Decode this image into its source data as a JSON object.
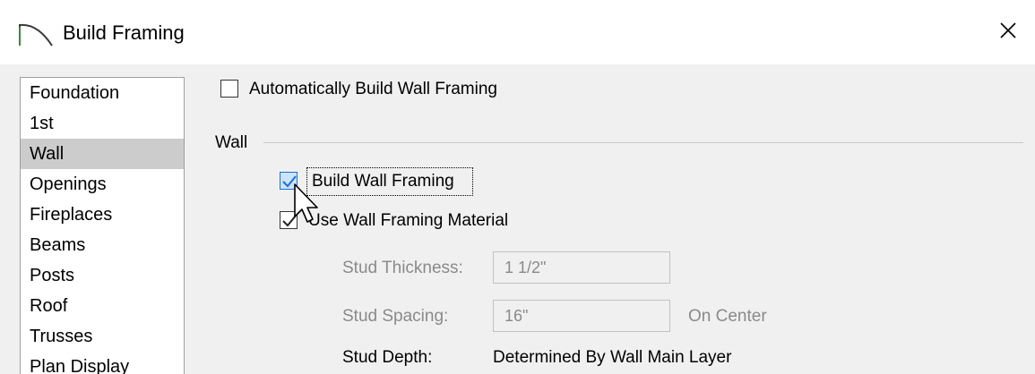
{
  "window": {
    "title": "Build Framing",
    "title_icon": "arc-icon",
    "close_icon": "close-icon"
  },
  "nav": {
    "items": [
      {
        "label": "Foundation",
        "selected": false
      },
      {
        "label": "1st",
        "selected": false
      },
      {
        "label": "Wall",
        "selected": true
      },
      {
        "label": "Openings",
        "selected": false
      },
      {
        "label": "Fireplaces",
        "selected": false
      },
      {
        "label": "Beams",
        "selected": false
      },
      {
        "label": "Posts",
        "selected": false
      },
      {
        "label": "Roof",
        "selected": false
      },
      {
        "label": "Trusses",
        "selected": false
      },
      {
        "label": "Plan Display",
        "selected": false
      }
    ]
  },
  "options": {
    "auto_build_label": "Automatically Build Wall Framing",
    "auto_build_checked": false
  },
  "wall_group": {
    "heading": "Wall",
    "build_framing_label": "Build Wall Framing",
    "build_framing_checked": true,
    "use_material_label": "Use Wall Framing Material",
    "use_material_checked": true,
    "stud_thickness_label": "Stud Thickness:",
    "stud_thickness_value": "1 1/2\"",
    "stud_spacing_label": "Stud Spacing:",
    "stud_spacing_value": "16\"",
    "stud_spacing_suffix": "On Center",
    "stud_depth_label": "Stud Depth:",
    "stud_depth_value": "Determined By Wall Main Layer"
  },
  "colors": {
    "selected_item_bg": "#cccccc",
    "checkbox_focus_blue": "#1a6fd6",
    "disabled_text": "#8a8a8a"
  }
}
